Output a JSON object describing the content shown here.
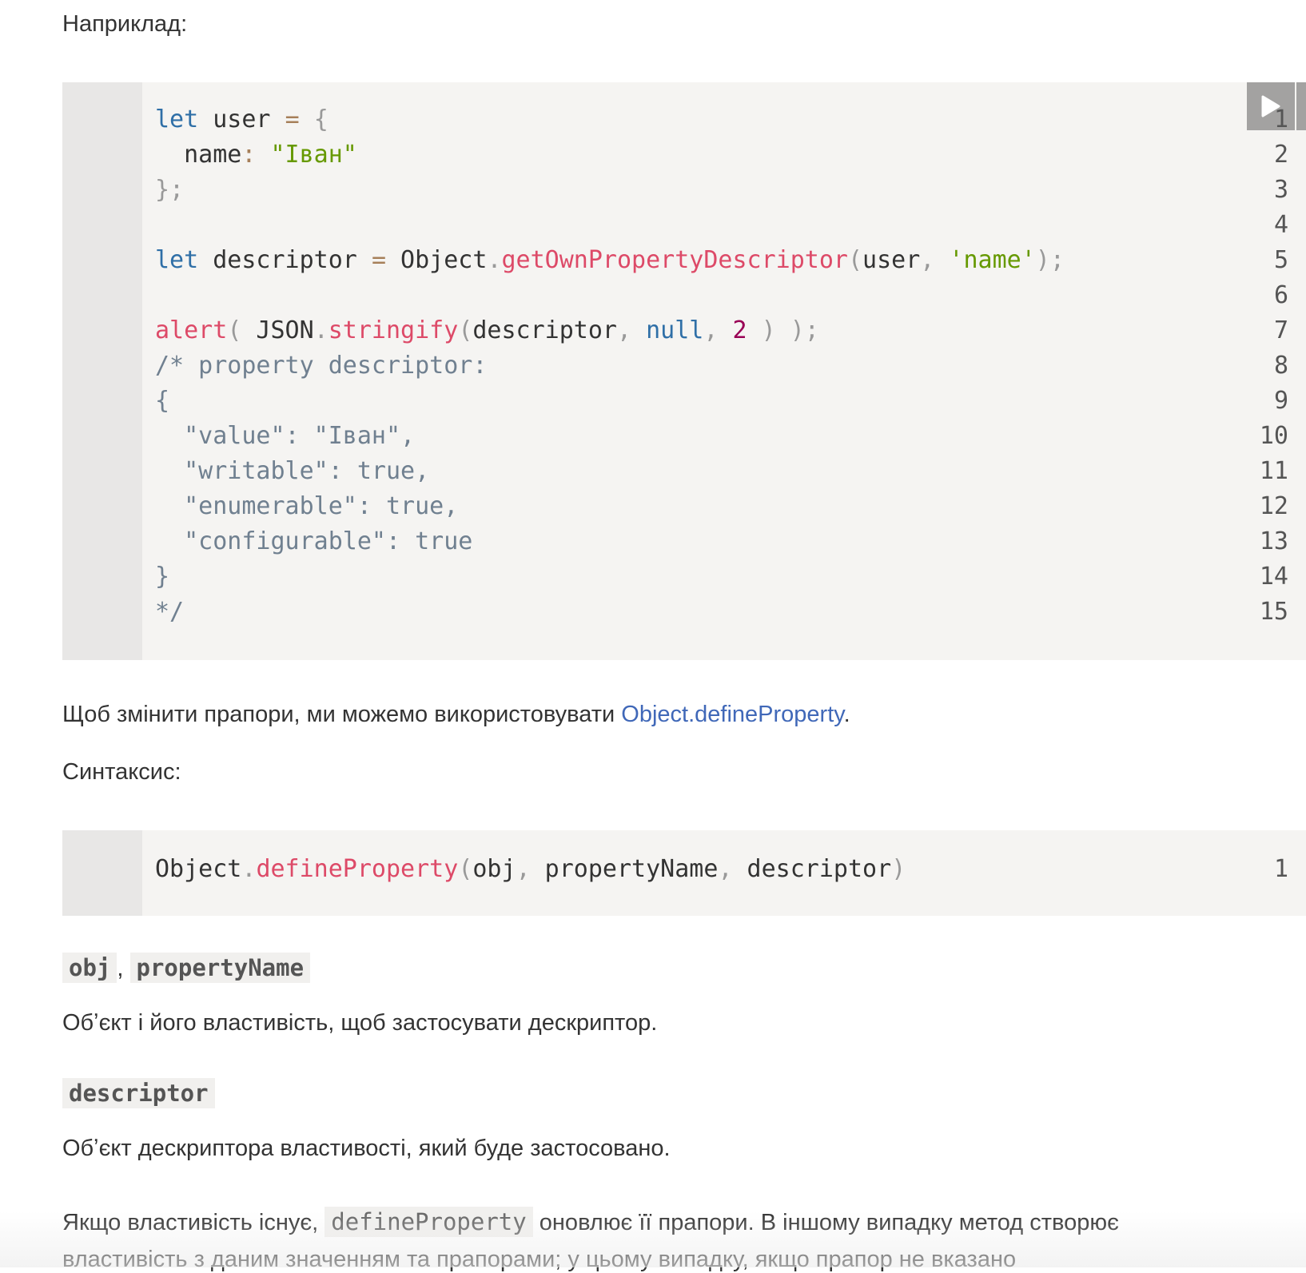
{
  "intro": "Наприклад:",
  "code1": {
    "lines": [
      [
        [
          "kw",
          "let"
        ],
        [
          "tx",
          " user "
        ],
        [
          "op",
          "="
        ],
        [
          "tx",
          " "
        ],
        [
          "pun",
          "{"
        ]
      ],
      [
        [
          "tx",
          "  name"
        ],
        [
          "op",
          ":"
        ],
        [
          "tx",
          " "
        ],
        [
          "str",
          "\"Іван\""
        ]
      ],
      [
        [
          "pun",
          "};"
        ]
      ],
      [],
      [
        [
          "kw",
          "let"
        ],
        [
          "tx",
          " descriptor "
        ],
        [
          "op",
          "="
        ],
        [
          "tx",
          " Object"
        ],
        [
          "pun",
          "."
        ],
        [
          "fn",
          "getOwnPropertyDescriptor"
        ],
        [
          "pun",
          "("
        ],
        [
          "tx",
          "user"
        ],
        [
          "pun",
          ","
        ],
        [
          "tx",
          " "
        ],
        [
          "str",
          "'name'"
        ],
        [
          "pun",
          ");"
        ]
      ],
      [],
      [
        [
          "fn",
          "alert"
        ],
        [
          "pun",
          "("
        ],
        [
          "tx",
          " JSON"
        ],
        [
          "pun",
          "."
        ],
        [
          "fn",
          "stringify"
        ],
        [
          "pun",
          "("
        ],
        [
          "tx",
          "descriptor"
        ],
        [
          "pun",
          ","
        ],
        [
          "tx",
          " "
        ],
        [
          "kw",
          "null"
        ],
        [
          "pun",
          ","
        ],
        [
          "tx",
          " "
        ],
        [
          "num",
          "2"
        ],
        [
          "tx",
          " "
        ],
        [
          "pun",
          ")"
        ],
        [
          "tx",
          " "
        ],
        [
          "pun",
          ");"
        ]
      ],
      [
        [
          "cm",
          "/* property descriptor:"
        ]
      ],
      [
        [
          "cm",
          "{"
        ]
      ],
      [
        [
          "cm",
          "  \"value\": \"Іван\","
        ]
      ],
      [
        [
          "cm",
          "  \"writable\": true,"
        ]
      ],
      [
        [
          "cm",
          "  \"enumerable\": true,"
        ]
      ],
      [
        [
          "cm",
          "  \"configurable\": true"
        ]
      ],
      [
        [
          "cm",
          "}"
        ]
      ],
      [
        [
          "cm",
          "*/"
        ]
      ]
    ],
    "run_icon": "play-icon"
  },
  "para1": {
    "text": "Щоб змінити прапори, ми можемо використовувати ",
    "link": "Object.defineProperty",
    "end": "."
  },
  "syntax": "Синтаксис:",
  "code2": {
    "lines": [
      [
        [
          "tx",
          "Object"
        ],
        [
          "pun",
          "."
        ],
        [
          "fn",
          "defineProperty"
        ],
        [
          "pun",
          "("
        ],
        [
          "tx",
          "obj"
        ],
        [
          "pun",
          ","
        ],
        [
          "tx",
          " propertyName"
        ],
        [
          "pun",
          ","
        ],
        [
          "tx",
          " descriptor"
        ],
        [
          "pun",
          ")"
        ]
      ]
    ]
  },
  "term1": {
    "a": "obj",
    "sep": ", ",
    "b": "propertyName",
    "desc": "Обʼєкт і його властивість, щоб застосувати дескриптор."
  },
  "term2": {
    "a": "descriptor",
    "desc": "Обʼєкт дескриптора властивості, який буде застосовано."
  },
  "para2": {
    "before": "Якщо властивість існує, ",
    "code": "defineProperty",
    "after": " оновлює її прапори. В іншому випадку метод створює",
    "line2": "властивість з даним значенням та прапорами; у цьому випадку, якщо прапор не вказано"
  }
}
